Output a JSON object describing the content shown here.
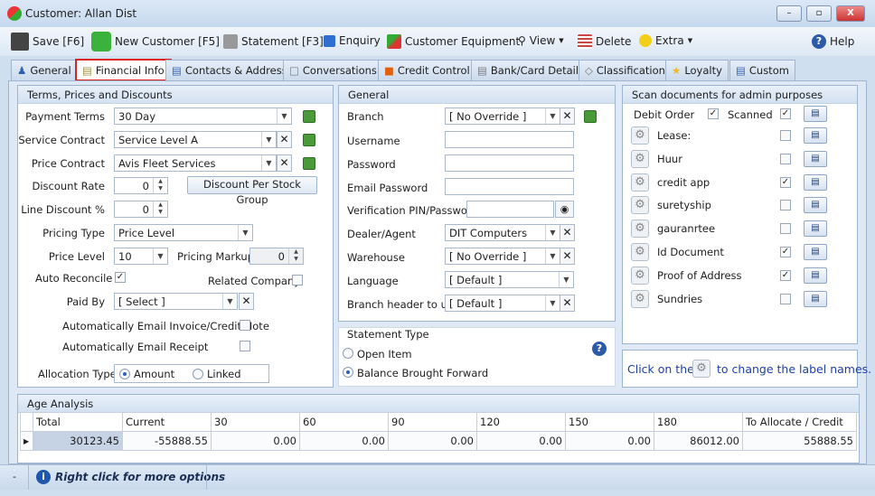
{
  "window": {
    "title": "Customer: Allan Dist",
    "minimize": "–",
    "maximize": "▫",
    "close": "X"
  },
  "toolbar": {
    "save": "Save [F6]",
    "new_customer": "New Customer [F5]",
    "statement": "Statement [F3]",
    "enquiry": "Enquiry",
    "customer_equipment": "Customer Equipment",
    "view": "View",
    "delete": "Delete",
    "extra": "Extra",
    "help": "Help"
  },
  "tabs": [
    {
      "label": "General"
    },
    {
      "label": "Financial Info",
      "active": true
    },
    {
      "label": "Contacts & Address"
    },
    {
      "label": "Conversations"
    },
    {
      "label": "Credit Control"
    },
    {
      "label": "Bank/Card Details"
    },
    {
      "label": "Classification"
    },
    {
      "label": "Loyalty"
    },
    {
      "label": "Custom"
    }
  ],
  "terms": {
    "title": "Terms, Prices and Discounts",
    "payment_terms_label": "Payment Terms",
    "payment_terms": "30 Day",
    "service_contract_label": "Service Contract",
    "service_contract": "Service Level A",
    "price_contract_label": "Price Contract",
    "price_contract": "Avis Fleet Services",
    "discount_rate_label": "Discount Rate",
    "discount_rate": "0",
    "discount_group_button": "Discount Per Stock Group",
    "line_discount_label": "Line Discount %",
    "line_discount": "0",
    "pricing_type_label": "Pricing Type",
    "pricing_type": "Price Level",
    "price_level_label": "Price Level",
    "price_level": "10",
    "pricing_markup_label": "Pricing Markup",
    "pricing_markup": "0",
    "auto_reconcile_label": "Auto Reconcile",
    "auto_reconcile": true,
    "related_company_label": "Related Company",
    "related_company": false,
    "paid_by_label": "Paid By",
    "paid_by": "[ Select ]",
    "auto_email_invoice_label": "Automatically Email Invoice/Credit Note",
    "auto_email_invoice": false,
    "auto_email_receipt_label": "Automatically Email Receipt",
    "auto_email_receipt": false,
    "allocation_type_label": "Allocation Type",
    "allocation_amount": "Amount",
    "allocation_linked": "Linked",
    "allocation_selected": "Amount"
  },
  "general": {
    "title": "General",
    "branch_label": "Branch",
    "branch": "[ No Override ]",
    "username_label": "Username",
    "username": "",
    "password_label": "Password",
    "password": "",
    "email_password_label": "Email Password",
    "email_password": "",
    "pin_label": "Verification PIN/Password",
    "pin": "",
    "dealer_label": "Dealer/Agent",
    "dealer": "DIT Computers",
    "warehouse_label": "Warehouse",
    "warehouse": "[ No Override ]",
    "language_label": "Language",
    "language": "[ Default ]",
    "branch_header_label": "Branch header to use",
    "branch_header": "[ Default ]"
  },
  "statement_type": {
    "title": "Statement Type",
    "open_item": "Open Item",
    "balance_forward": "Balance Brought Forward",
    "selected": "Balance Brought Forward"
  },
  "scan": {
    "title": "Scan documents for admin purposes",
    "debit_order_label": "Debit Order",
    "debit_order": true,
    "scanned_label": "Scanned",
    "debit_order_scanned": true,
    "items": [
      {
        "label": "Lease:",
        "scanned": false
      },
      {
        "label": "Huur",
        "scanned": false
      },
      {
        "label": "credit app",
        "scanned": true
      },
      {
        "label": "suretyship",
        "scanned": false
      },
      {
        "label": "gauranrtee",
        "scanned": false
      },
      {
        "label": "Id Document",
        "scanned": true
      },
      {
        "label": "Proof of Address",
        "scanned": true
      },
      {
        "label": "Sundries",
        "scanned": false
      }
    ],
    "hint_before": "Click on the",
    "hint_after": "to change the label names."
  },
  "age_analysis": {
    "title": "Age Analysis",
    "columns": [
      "Total",
      "Current",
      "30",
      "60",
      "90",
      "120",
      "150",
      "180",
      "To Allocate / Credit"
    ],
    "values": [
      "30123.45",
      "-55888.55",
      "0.00",
      "0.00",
      "0.00",
      "0.00",
      "0.00",
      "86012.00",
      "55888.55"
    ]
  },
  "status": {
    "dash": "-",
    "hint": "Right click for more options"
  }
}
